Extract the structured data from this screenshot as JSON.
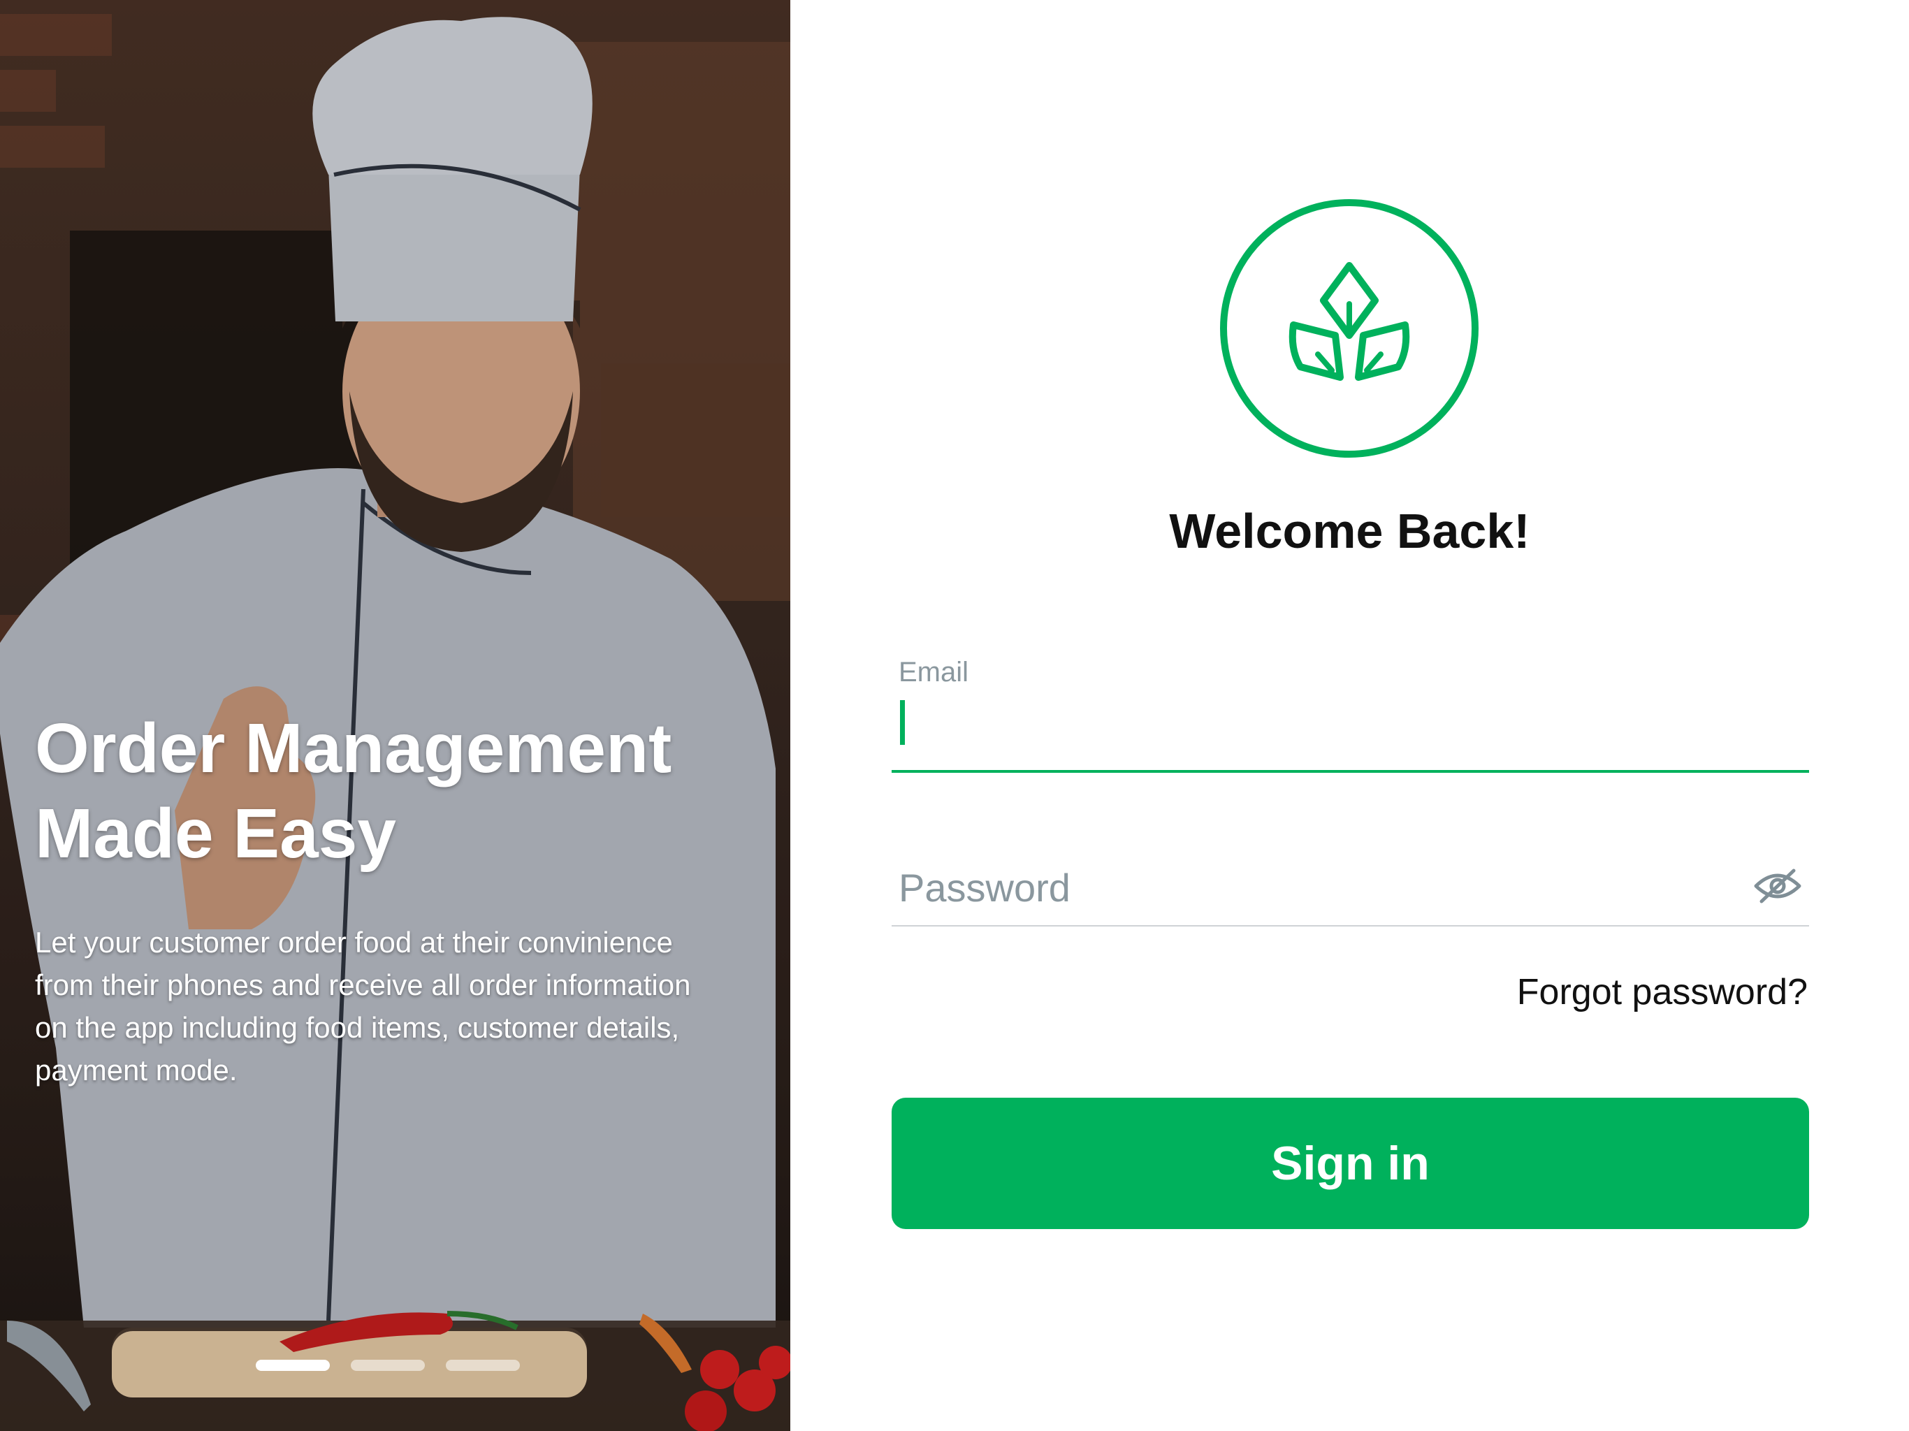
{
  "hero": {
    "title_line1": "Order Management",
    "title_line2": "Made Easy",
    "description_lines": [
      "Let your customer order food at their  convinience",
      "from their phones and receive all order information",
      "on the app including food items, customer details,",
      "payment mode."
    ],
    "carousel": {
      "total": 3,
      "active_index": 0
    },
    "image_subject": "chef-in-kitchen"
  },
  "login": {
    "logo_icon": "leaf-sprout-icon",
    "welcome": "Welcome Back!",
    "email": {
      "label": "Email",
      "value": ""
    },
    "password": {
      "placeholder": "Password",
      "visibility_icon": "eye-slash-icon"
    },
    "forgot_password": "Forgot password?",
    "sign_in": "Sign in"
  },
  "colors": {
    "accent": "#00b15c",
    "label_gray": "#8a979e",
    "text_dark": "#111111"
  }
}
